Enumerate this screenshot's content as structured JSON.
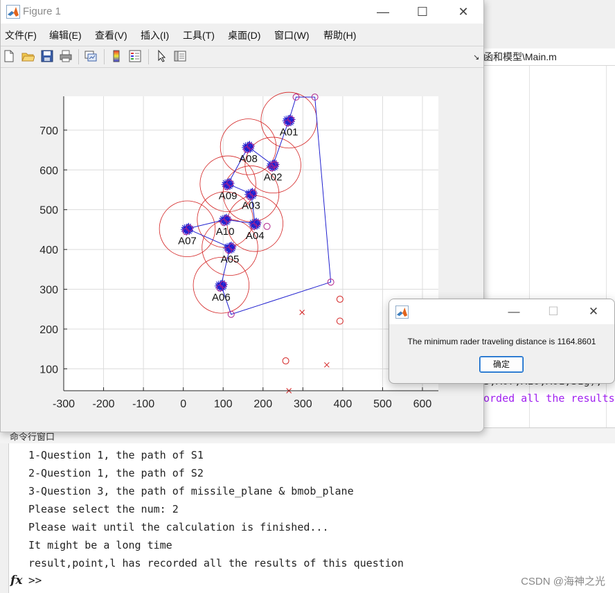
{
  "figure": {
    "title": "Figure 1",
    "menu": [
      "文件(F)",
      "编辑(E)",
      "查看(V)",
      "插入(I)",
      "工具(T)",
      "桌面(D)",
      "窗口(W)",
      "帮助(H)"
    ],
    "toolbar_icons": [
      "new-figure-icon",
      "open-file-icon",
      "save-icon",
      "print-icon",
      "link-plot-icon",
      "insert-colorbar-icon",
      "insert-legend-icon",
      "edit-plot-arrow-icon",
      "property-inspector-icon"
    ]
  },
  "background": {
    "path_text": "函和模型\\Main.m",
    "code_line_1": "S,A07,A10,A01,S1g);",
    "code_line_2": "orded all the results"
  },
  "command_window": {
    "header": "命令行窗口",
    "lines": [
      "1-Question 1, the path of S1",
      "2-Question 1, the path of S2",
      "3-Question 3, the path of missile_plane & bmob_plane",
      "Please select the num: 2",
      "Please wait until the calculation is finished...",
      "It might be a long time",
      "result,point,l has recorded all the results of this question"
    ],
    "fx": "fx",
    "prompt": ">>",
    "watermark": "CSDN @海神之光"
  },
  "dialog": {
    "message": "The minimum rader traveling distance is 1164.8601",
    "ok_label": "确定"
  },
  "colors": {
    "path": "#1f1fcf",
    "circle": "#d32020",
    "grid": "#dcdcdc"
  },
  "chart_data": {
    "type": "scatter",
    "xlim": [
      -300,
      640
    ],
    "ylim": [
      45,
      785
    ],
    "xticks": [
      -300,
      -200,
      -100,
      0,
      100,
      200,
      300,
      400,
      500,
      600
    ],
    "yticks": [
      100,
      200,
      300,
      400,
      500,
      600,
      700
    ],
    "grid": true,
    "radius": 70,
    "targets": [
      {
        "label": "A01",
        "x": 265,
        "y": 725
      },
      {
        "label": "A02",
        "x": 225,
        "y": 612
      },
      {
        "label": "A03",
        "x": 170,
        "y": 540
      },
      {
        "label": "A04",
        "x": 180,
        "y": 465
      },
      {
        "label": "A05",
        "x": 117,
        "y": 405
      },
      {
        "label": "A06",
        "x": 95,
        "y": 310
      },
      {
        "label": "A07",
        "x": 10,
        "y": 452
      },
      {
        "label": "A08",
        "x": 163,
        "y": 658
      },
      {
        "label": "A09",
        "x": 112,
        "y": 565
      },
      {
        "label": "A10",
        "x": 105,
        "y": 475
      }
    ],
    "path": [
      [
        330,
        783
      ],
      [
        283,
        783
      ],
      [
        265,
        725
      ],
      [
        225,
        612
      ],
      [
        163,
        658
      ],
      [
        112,
        565
      ],
      [
        170,
        540
      ],
      [
        180,
        465
      ],
      [
        105,
        475
      ],
      [
        10,
        452
      ],
      [
        117,
        405
      ],
      [
        95,
        310
      ],
      [
        120,
        237
      ],
      [
        370,
        318
      ],
      [
        330,
        783
      ]
    ],
    "path_circles": [
      [
        283,
        783
      ],
      [
        330,
        783
      ],
      [
        370,
        318
      ],
      [
        120,
        237
      ],
      [
        210,
        458
      ],
      [
        225,
        612
      ]
    ],
    "outlier_circles": [
      [
        393,
        275
      ],
      [
        393,
        220
      ],
      [
        257,
        120
      ]
    ],
    "outlier_crosses": [
      [
        298,
        242
      ],
      [
        360,
        110
      ],
      [
        265,
        45
      ]
    ]
  }
}
